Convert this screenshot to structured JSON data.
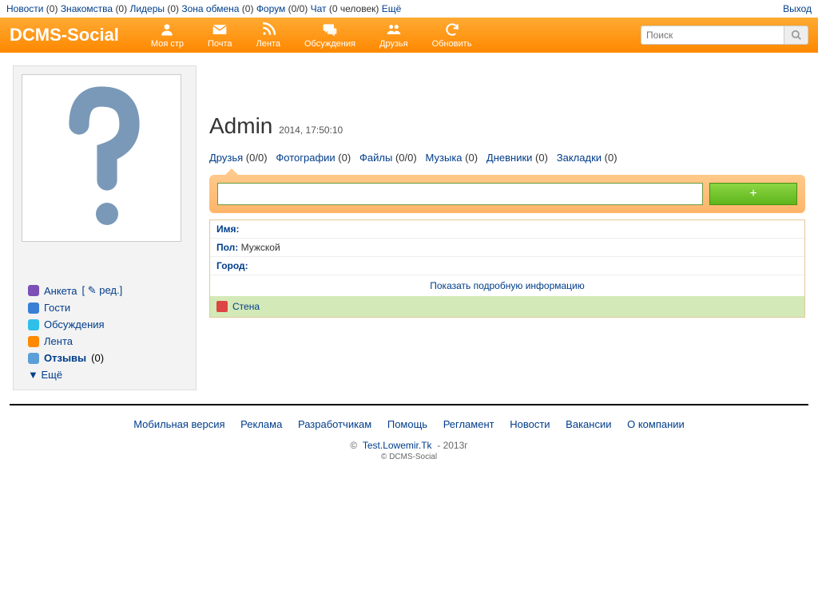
{
  "topnav": {
    "items": [
      {
        "label": "Новости",
        "count": "(0)"
      },
      {
        "label": "Знакомства",
        "count": "(0)"
      },
      {
        "label": "Лидеры",
        "count": "(0)"
      },
      {
        "label": "Зона обмена",
        "count": "(0)"
      },
      {
        "label": "Форум",
        "count": "(0/0)"
      },
      {
        "label": "Чат",
        "count": "(0 человек)"
      },
      {
        "label": "Ещё",
        "count": ""
      }
    ],
    "logout": "Выход"
  },
  "header": {
    "logo": "DCMS-Social",
    "nav": [
      "Моя стр",
      "Почта",
      "Лента",
      "Обсуждения",
      "Друзья",
      "Обновить"
    ],
    "search_placeholder": "Поиск"
  },
  "sidebar": {
    "items": [
      {
        "label": "Анкета",
        "edit": "[ ✎ ред.]"
      },
      {
        "label": "Гости"
      },
      {
        "label": "Обсуждения"
      },
      {
        "label": "Лента"
      },
      {
        "label": "Отзывы",
        "count": "(0)"
      }
    ],
    "more": "▼ Ещё"
  },
  "profile": {
    "name": "Admin",
    "timestamp": "2014, 17:50:10",
    "tabs": [
      {
        "label": "Друзья",
        "count": "(0/0)"
      },
      {
        "label": "Фотографии",
        "count": "(0)"
      },
      {
        "label": "Файлы",
        "count": "(0/0)"
      },
      {
        "label": "Музыка",
        "count": "(0)"
      },
      {
        "label": "Дневники",
        "count": "(0)"
      },
      {
        "label": "Закладки",
        "count": "(0)"
      }
    ],
    "post_button": "+",
    "info": {
      "name_label": "Имя:",
      "gender_label": "Пол:",
      "gender_value": "Мужской",
      "city_label": "Город:",
      "more": "Показать подробную информацию"
    },
    "wall": "Стена"
  },
  "footer": {
    "links": [
      "Мобильная версия",
      "Реклама",
      "Разработчикам",
      "Помощь",
      "Регламент",
      "Новости",
      "Вакансии",
      "О компании"
    ],
    "copy_prefix": "©",
    "site": "Test.Lowemir.Tk",
    "year": "- 2013г",
    "brand": "© DCMS-Social"
  }
}
